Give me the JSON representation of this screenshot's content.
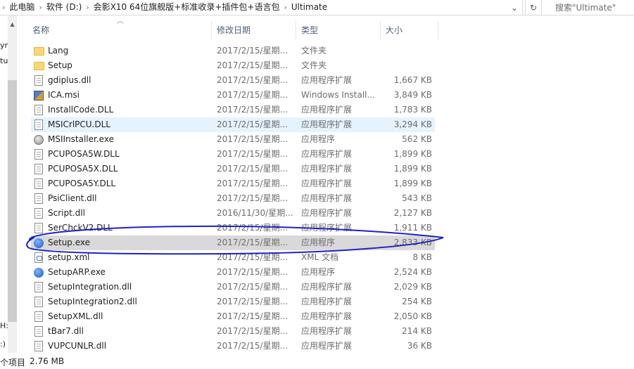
{
  "address": {
    "crumbs": [
      "此电脑",
      "软件 (D:)",
      "会影X10 64位旗舰版+标准收录+插件包+语言包",
      "Ultimate"
    ],
    "dropdown_glyph": "⌄",
    "refresh_glyph": "↻"
  },
  "search": {
    "placeholder": "搜索\"Ultimate\""
  },
  "nav": {
    "fragments": [
      "yn",
      "tu",
      "H:",
      ":)"
    ]
  },
  "columns": {
    "name": "名称",
    "date": "修改日期",
    "type": "类型",
    "size": "大小"
  },
  "files": [
    {
      "name": "Lang",
      "date": "2017/2/15/星期...",
      "type": "文件夹",
      "size": "",
      "icon": "folder-icon"
    },
    {
      "name": "Setup",
      "date": "2017/2/15/星期...",
      "type": "文件夹",
      "size": "",
      "icon": "folder-icon"
    },
    {
      "name": "gdiplus.dll",
      "date": "2017/2/15/星期...",
      "type": "应用程序扩展",
      "size": "1,667 KB",
      "icon": "dll-file-icon"
    },
    {
      "name": "ICA.msi",
      "date": "2017/2/15/星期...",
      "type": "Windows Install...",
      "size": "3,849 KB",
      "icon": "msi-package-icon"
    },
    {
      "name": "InstallCode.DLL",
      "date": "2017/2/15/星期...",
      "type": "应用程序扩展",
      "size": "1,783 KB",
      "icon": "dll-file-icon"
    },
    {
      "name": "MSICrlPCU.DLL",
      "date": "2017/2/15/星期...",
      "type": "应用程序扩展",
      "size": "3,294 KB",
      "icon": "dll-file-icon",
      "state": "hover"
    },
    {
      "name": "MSIInstaller.exe",
      "date": "2017/2/15/星期...",
      "type": "应用程序",
      "size": "562 KB",
      "icon": "exe-icon"
    },
    {
      "name": "PCUPOSA5W.DLL",
      "date": "2017/2/15/星期...",
      "type": "应用程序扩展",
      "size": "1,899 KB",
      "icon": "dll-file-icon"
    },
    {
      "name": "PCUPOSA5X.DLL",
      "date": "2017/2/15/星期...",
      "type": "应用程序扩展",
      "size": "1,899 KB",
      "icon": "dll-file-icon"
    },
    {
      "name": "PCUPOSA5Y.DLL",
      "date": "2017/2/15/星期...",
      "type": "应用程序扩展",
      "size": "1,899 KB",
      "icon": "dll-file-icon"
    },
    {
      "name": "PsiClient.dll",
      "date": "2017/2/15/星期...",
      "type": "应用程序扩展",
      "size": "543 KB",
      "icon": "dll-file-icon"
    },
    {
      "name": "Script.dll",
      "date": "2016/11/30/星期...",
      "type": "应用程序扩展",
      "size": "2,127 KB",
      "icon": "dll-file-icon"
    },
    {
      "name": "SerChckV2.DLL",
      "date": "2017/2/15/星期...",
      "type": "应用程序扩展",
      "size": "1,911 KB",
      "icon": "dll-file-icon"
    },
    {
      "name": "Setup.exe",
      "date": "2017/2/15/星期...",
      "type": "应用程序",
      "size": "2,833 KB",
      "icon": "setup-exe-icon",
      "state": "selected"
    },
    {
      "name": "setup.xml",
      "date": "2017/2/15/星期...",
      "type": "XML 文档",
      "size": "8 KB",
      "icon": "xml-file-icon"
    },
    {
      "name": "SetupARP.exe",
      "date": "2017/2/15/星期...",
      "type": "应用程序",
      "size": "2,524 KB",
      "icon": "setup-exe-icon"
    },
    {
      "name": "SetupIntegration.dll",
      "date": "2017/2/15/星期...",
      "type": "应用程序扩展",
      "size": "2,029 KB",
      "icon": "dll-file-icon"
    },
    {
      "name": "SetupIntegration2.dll",
      "date": "2017/2/15/星期...",
      "type": "应用程序扩展",
      "size": "254 KB",
      "icon": "dll-file-icon"
    },
    {
      "name": "SetupXML.dll",
      "date": "2017/2/15/星期...",
      "type": "应用程序扩展",
      "size": "2,050 KB",
      "icon": "dll-file-icon"
    },
    {
      "name": "tBar7.dll",
      "date": "2017/2/15/星期...",
      "type": "应用程序扩展",
      "size": "214 KB",
      "icon": "dll-file-icon"
    },
    {
      "name": "VUPCUNLR.dll",
      "date": "2017/2/15/星期...",
      "type": "应用程序扩展",
      "size": "36 KB",
      "icon": "dll-file-icon"
    }
  ],
  "status": {
    "count_text": "个项目",
    "selected_size": "2.76 MB"
  },
  "colors": {
    "hover": "#e5f3ff",
    "selected": "#d9d9d9",
    "annotation": "#1d22c9",
    "header_text": "#4c607a"
  }
}
